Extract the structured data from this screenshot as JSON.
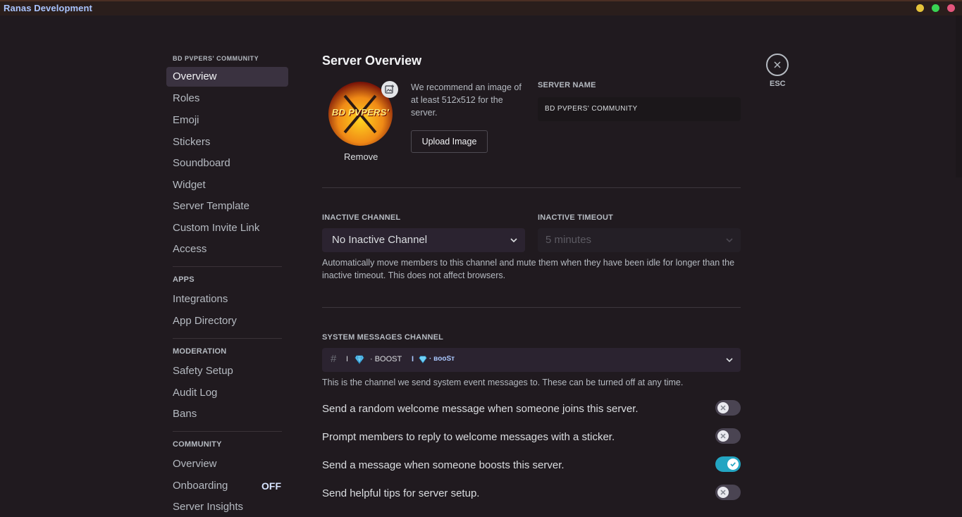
{
  "app": {
    "title": "Ranas Development"
  },
  "window_controls": [
    {
      "name": "minimize",
      "color": "#e5c33a"
    },
    {
      "name": "maximize",
      "color": "#39d353"
    },
    {
      "name": "close",
      "color": "#e4557c"
    }
  ],
  "sidebar": {
    "server_name": "BD PVPERS' COMMUNITY",
    "items": [
      {
        "label": "Overview",
        "selected": true
      },
      {
        "label": "Roles"
      },
      {
        "label": "Emoji"
      },
      {
        "label": "Stickers"
      },
      {
        "label": "Soundboard"
      },
      {
        "label": "Widget"
      },
      {
        "label": "Server Template"
      },
      {
        "label": "Custom Invite Link"
      },
      {
        "label": "Access"
      }
    ],
    "apps": {
      "header": "APPS",
      "items": [
        {
          "label": "Integrations"
        },
        {
          "label": "App Directory"
        }
      ]
    },
    "moderation": {
      "header": "MODERATION",
      "items": [
        {
          "label": "Safety Setup"
        },
        {
          "label": "Audit Log"
        },
        {
          "label": "Bans"
        }
      ]
    },
    "community": {
      "header": "COMMUNITY",
      "items": [
        {
          "label": "Overview"
        },
        {
          "label": "Onboarding",
          "badge": "OFF"
        },
        {
          "label": "Server Insights"
        }
      ]
    }
  },
  "main": {
    "title": "Server Overview",
    "server_icon_text": "BD PVPERS'",
    "remove_label": "Remove",
    "recommend_text": "We recommend an image of at least 512x512 for the server.",
    "upload_label": "Upload Image",
    "server_name_label": "SERVER NAME",
    "server_name_value": "BD PVPERS' COMMUNITY",
    "inactive_channel_label": "INACTIVE CHANNEL",
    "inactive_channel_value": "No Inactive Channel",
    "inactive_timeout_label": "INACTIVE TIMEOUT",
    "inactive_timeout_value": "5 minutes",
    "inactive_help": "Automatically move members to this channel and mute them when they have been idle for longer than the inactive timeout. This does not affect browsers.",
    "system_channel_label": "SYSTEM MESSAGES CHANNEL",
    "system_channel_parts": [
      "I",
      "·  BOOST",
      "I",
      "· ʙᴏᴏSᴛ"
    ],
    "system_help": "This is the channel we send system event messages to. These can be turned off at any time.",
    "toggles": [
      {
        "label": "Send a random welcome message when someone joins this server.",
        "on": false
      },
      {
        "label": "Prompt members to reply to welcome messages with a sticker.",
        "on": false
      },
      {
        "label": "Send a message when someone boosts this server.",
        "on": true
      },
      {
        "label": "Send helpful tips for server setup.",
        "on": false
      }
    ]
  },
  "close": {
    "label": "ESC"
  }
}
